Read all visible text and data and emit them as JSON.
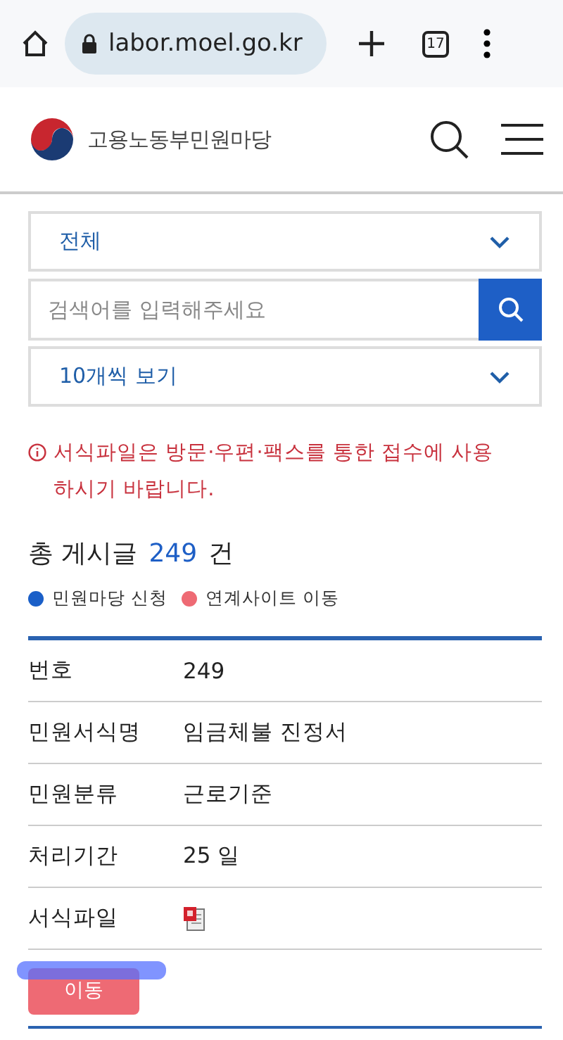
{
  "browser": {
    "url": "labor.moel.go.kr",
    "tab_count": "17"
  },
  "header": {
    "site_title": "고용노동부민원마당"
  },
  "filters": {
    "category": {
      "value": "전체"
    },
    "search": {
      "placeholder": "검색어를 입력해주세요"
    },
    "page_size": {
      "value": "10개씩 보기"
    }
  },
  "notice": "서식파일은 방문·우편·팩스를 통한 접수에 사용하시기 바랍니다.",
  "total": {
    "label": "총 게시글",
    "count": "249",
    "unit": "건"
  },
  "legend": [
    {
      "label": "민원마당 신청",
      "color": "#1a5fc8"
    },
    {
      "label": "연계사이트 이동",
      "color": "#ee6a74"
    }
  ],
  "record": [
    {
      "kind": "text",
      "label": "번호",
      "value": "249"
    },
    {
      "kind": "text",
      "label": "민원서식명",
      "value": "임금체불 진정서"
    },
    {
      "kind": "text",
      "label": "민원분류",
      "value": "근로기준"
    },
    {
      "kind": "text",
      "label": "처리기간",
      "value": "25 일"
    },
    {
      "kind": "file",
      "label": "서식파일"
    }
  ],
  "action_button": {
    "label": "이동",
    "color": "#ee6a74",
    "highlighted": true
  }
}
